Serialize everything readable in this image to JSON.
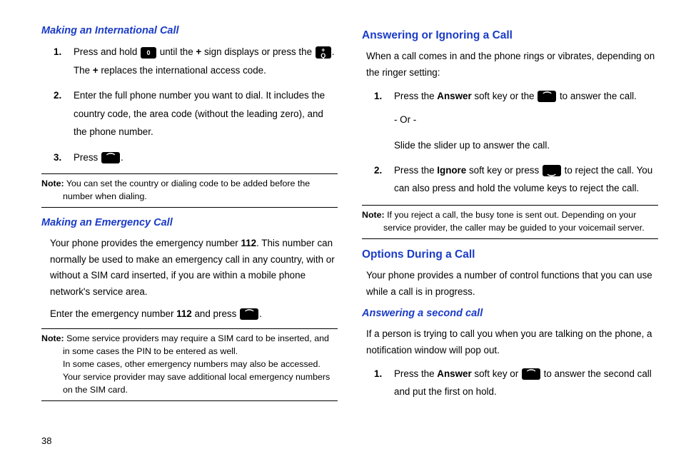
{
  "pageNumber": "38",
  "left": {
    "h1": "Making an International Call",
    "step1a": "Press and hold ",
    "step1b": " until the ",
    "step1c": " sign displays or press the ",
    "step1d": ". The ",
    "step1e": " replaces the international access code.",
    "plus": "+",
    "step2": "Enter the full phone number you want to dial. It includes the country code, the area code (without the leading zero), and the phone number.",
    "step3a": "Press ",
    "step3b": ".",
    "note1Label": "Note:",
    "note1": " You can set the country or dialing code to be added before the number when dialing.",
    "h2": "Making an Emergency Call",
    "p1a": "Your phone provides the emergency number ",
    "p1num": "112",
    "p1b": ". This number can normally be used to make an emergency call in any country, with or without a SIM card inserted, if you are within a mobile phone network's service area.",
    "p2a": "Enter the emergency number ",
    "p2b": " and press ",
    "p2c": ".",
    "note2Label": "Note:",
    "note2a": " Some service providers may require a SIM card to be inserted, and in some cases the PIN to be entered as well.",
    "note2b": "In some cases, other emergency numbers may also be accessed. Your service provider may save additional local emergency numbers on the SIM card."
  },
  "right": {
    "h1": "Answering or Ignoring a Call",
    "p1": "When a call comes in and the phone rings or vibrates, depending on the ringer setting:",
    "step1a": "Press the ",
    "answer": "Answer",
    "step1b": " soft key or the ",
    "step1c": " to answer the call.",
    "or": "- Or -",
    "slide": "Slide the slider up to answer the call.",
    "step2a": "Press the ",
    "ignore": "Ignore",
    "step2b": " soft key or press ",
    "step2c": " to reject the call. You can also press and hold the volume keys to reject the call.",
    "note1Label": "Note:",
    "note1": " If you reject a call, the busy tone is sent out. Depending on your service provider, the caller may be guided to your voicemail server.",
    "h2": "Options During a Call",
    "p2": "Your phone provides a number of control functions that you can use while a call is in progress.",
    "h3": "Answering a second call",
    "p3": "If a person is trying to call you when you are talking on the phone, a notification window will pop out.",
    "s2step1a": "Press the ",
    "s2step1b": " soft key or ",
    "s2step1c": " to answer the second call and put the first on hold."
  }
}
